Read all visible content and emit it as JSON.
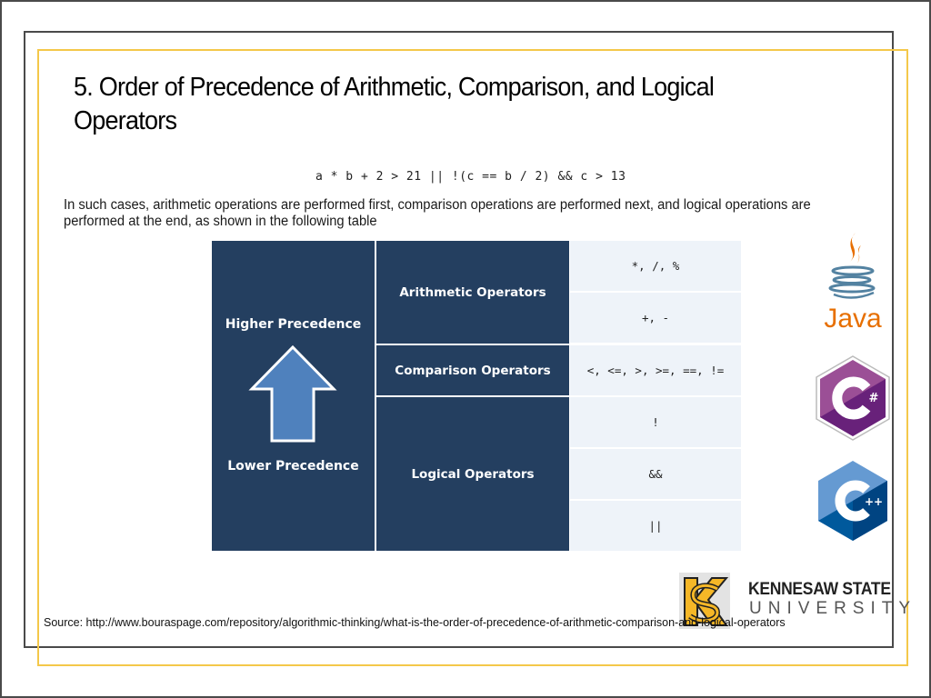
{
  "slide": {
    "title": "5.  Order of Precedence of Arithmetic, Comparison, and Logical Operators",
    "expression": "a * b + 2 > 21 || !(c == b / 2) && c > 13",
    "description": "In such cases, arithmetic operations are performed first, comparison operations are performed next, and logical operations are performed at the end, as shown in the following table",
    "source": "Source: http://www.bouraspage.com/repository/algorithmic-thinking/what-is-the-order-of-precedence-of-arithmetic-comparison-and-logical-operators"
  },
  "table": {
    "precedence": {
      "higher": "Higher Precedence",
      "lower": "Lower Precedence",
      "arrow_icon": "up-arrow-icon"
    },
    "categories": [
      {
        "label": "Arithmetic Operators",
        "operators": [
          "*, /, %",
          "+, -"
        ]
      },
      {
        "label": "Comparison Operators",
        "operators": [
          "<, <=, >, >=, ==, !="
        ]
      },
      {
        "label": "Logical Operators",
        "operators": [
          "!",
          "&&",
          "||"
        ]
      }
    ],
    "colors": {
      "header_bg": "#243f60",
      "cell_bg": "#eef3f9",
      "arrow_fill": "#4f81bd"
    }
  },
  "logos": {
    "languages": [
      {
        "name": "Java",
        "icon": "java-logo-icon",
        "text": "Java"
      },
      {
        "name": "C#",
        "icon": "csharp-logo-icon",
        "text": "#"
      },
      {
        "name": "C++",
        "icon": "cpp-logo-icon",
        "text": "++"
      }
    ],
    "university": {
      "line1": "KENNESAW STATE",
      "line2": "UNIVERSITY",
      "icon": "ksu-monogram-icon"
    }
  },
  "colors": {
    "frame_border": "#4a4a4a",
    "accent_gold": "#f4c84a"
  }
}
